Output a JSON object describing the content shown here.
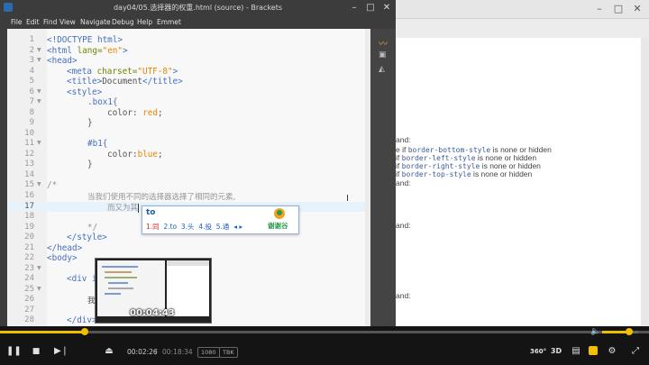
{
  "editor": {
    "title": "day04/05.选择器的权重.html (source) - Brackets",
    "menu": [
      "File",
      "Edit",
      "Find",
      "View",
      "Navigate",
      "Debug",
      "Help",
      "Emmet"
    ],
    "line_numbers": [
      "1",
      "2",
      "3",
      "4",
      "5",
      "6",
      "7",
      "8",
      "9",
      "10",
      "11",
      "12",
      "13",
      "14",
      "15",
      "16",
      "17",
      "18",
      "19",
      "20",
      "21",
      "22",
      "23",
      "24",
      "25",
      "26",
      "27",
      "28"
    ],
    "code": {
      "l1": "<!DOCTYPE html>",
      "l2_open": "<html",
      "l2_attr": " lang=",
      "l2_val": "\"en\"",
      "l2_close": ">",
      "l3": "<head>",
      "l4_open": "<meta",
      "l4_attr": " charset=",
      "l4_val": "\"UTF-8\"",
      "l4_close": ">",
      "l5_open": "<title>",
      "l5_text": "Document",
      "l5_close": "</title>",
      "l6": "<style>",
      "l7": ".box1{",
      "l8_prop": "color: ",
      "l8_val": "red",
      "l8_end": ";",
      "l9": "}",
      "l11": "#b1{",
      "l12_prop": "color:",
      "l12_val": "blue",
      "l12_end": ";",
      "l13": "}",
      "l15": "/*",
      "l16": "当我们使用不同的选择器选择了相同的元素,",
      "l17": "而又为其",
      "l19": "*/",
      "l20": "</style>",
      "l21": "</head>",
      "l22": "<body>",
      "l24": "<div id",
      "l26": "我是",
      "l28": "</div>"
    }
  },
  "ime": {
    "input": "to",
    "candidates": [
      "1.同",
      "2.to",
      "3.头",
      "4.投",
      "5.通"
    ],
    "nav": "◂ ▸",
    "brand": "谢谢谷"
  },
  "thumbnail": {
    "time": "00:04:43"
  },
  "docs_panel": {
    "lines": [
      {
        "pre": "and:",
        "code": "",
        "post": ""
      },
      {
        "pre": "e if ",
        "code": "border-bottom-style",
        "post": " is none or hidden"
      },
      {
        "pre": "if ",
        "code": "border-left-style",
        "post": " is none or hidden"
      },
      {
        "pre": " if ",
        "code": "border-right-style",
        "post": " is none or hidden"
      },
      {
        "pre": "if ",
        "code": "border-top-style",
        "post": " is none or hidden"
      },
      {
        "pre": "and:",
        "code": "",
        "post": ""
      },
      {
        "pre": "and:",
        "code": "",
        "post": ""
      },
      {
        "pre": "and:",
        "code": "",
        "post": ""
      }
    ]
  },
  "player": {
    "time_current": "00:02:26",
    "time_separator": "/",
    "time_total": "00:18:34",
    "progress_fraction": 0.1311,
    "volume_fraction": 0.75,
    "badge_1": "1080",
    "badge_2": "TBK",
    "btn_360": "360°",
    "btn_3d": "3D"
  },
  "colors": {
    "accent": "#f0c000",
    "tag": "#446fbd",
    "string": "#e88501"
  }
}
